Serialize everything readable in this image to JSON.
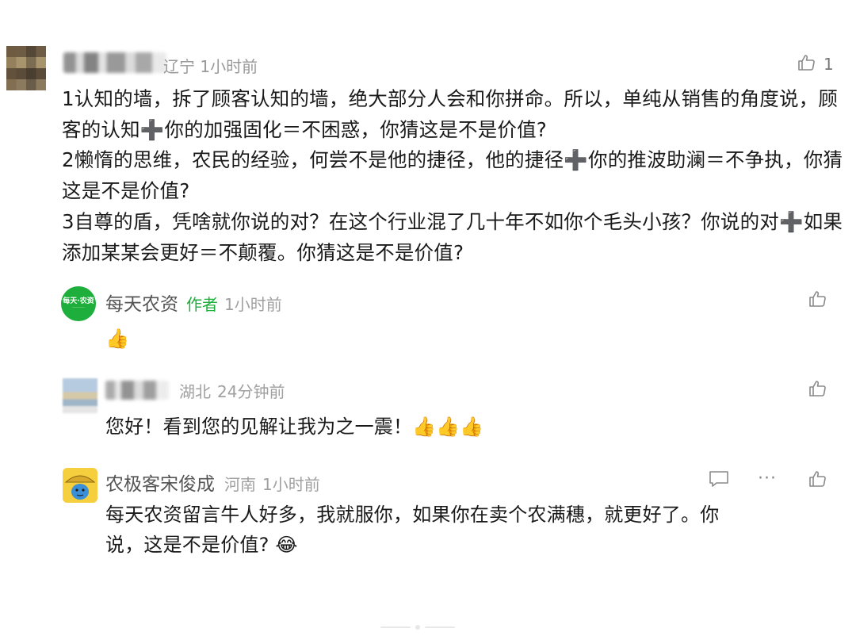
{
  "main_comment": {
    "location": "辽宁",
    "time": "1小时前",
    "like_count": "1",
    "paragraphs": [
      "1认知的墙，拆了顾客认知的墙，绝大部分人会和你拼命。所以，单纯从销售的角度说，顾客的认知➕你的加强固化＝不困惑，你猜这是不是价值?",
      "2懒惰的思维，农民的经验，何尝不是他的捷径，他的捷径➕你的推波助澜＝不争执，你猜这是不是价值?",
      "3自尊的盾，凭啥就你说的对？在这个行业混了几十年不如你个毛头小孩？你说的对➕如果添加某某会更好＝不颠覆。你猜这是不是价值?"
    ]
  },
  "replies": [
    {
      "name": "每天农资",
      "tag": "作者",
      "time": "1小时前",
      "avatar_text": "每天·农资",
      "text": "👍"
    },
    {
      "name": "",
      "location": "湖北",
      "time": "24分钟前",
      "text": "您好！看到您的见解让我为之一震！👍👍👍"
    },
    {
      "name": "农极客宋俊成",
      "location": "河南",
      "time": "1小时前",
      "text_line1": "每天农资留言牛人好多，我就服你，如果你在卖个农满穗，就更好了。你",
      "text_line2": "说，这是不是价值? 😂",
      "more": "···"
    }
  ],
  "icons": [
    "like-icon",
    "reply-icon",
    "more-icon"
  ],
  "colors": {
    "accent": "#1eae3b",
    "meta": "#999999",
    "text": "#1a1a1a"
  }
}
